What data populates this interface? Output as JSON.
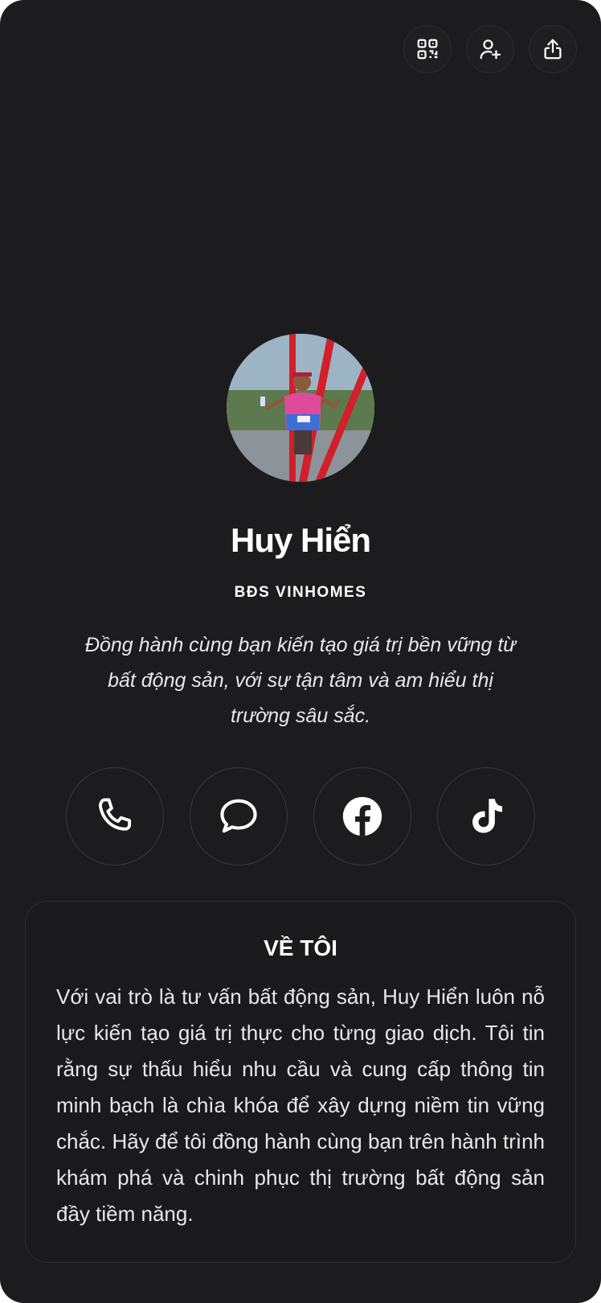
{
  "header": {
    "actions": [
      {
        "icon": "qr-code-icon"
      },
      {
        "icon": "add-contact-icon"
      },
      {
        "icon": "share-icon"
      }
    ]
  },
  "profile": {
    "name": "Huy Hiển",
    "company": "BĐS VINHOMES",
    "tagline": "Đồng hành cùng bạn kiến tạo giá trị bền vững từ bất động sản, với sự tận tâm và am hiểu thị trường sâu sắc."
  },
  "socials": [
    {
      "icon": "phone-icon"
    },
    {
      "icon": "message-icon"
    },
    {
      "icon": "facebook-icon"
    },
    {
      "icon": "tiktok-icon"
    }
  ],
  "about": {
    "title": "VỀ TÔI",
    "text": "Với vai trò là tư vấn bất động sản, Huy Hiển luôn nỗ lực kiến tạo giá trị thực cho từng giao dịch. Tôi tin rằng sự thấu hiểu nhu cầu và cung cấp thông tin minh bạch là chìa khóa để xây dựng niềm tin vững chắc. Hãy để tôi đồng hành cùng bạn trên hành trình khám phá và chinh phục thị trường bất động sản đầy tiềm năng."
  },
  "colors": {
    "background": "#1c1c1e",
    "card_border": "#2e2e32",
    "text": "#ffffff"
  }
}
